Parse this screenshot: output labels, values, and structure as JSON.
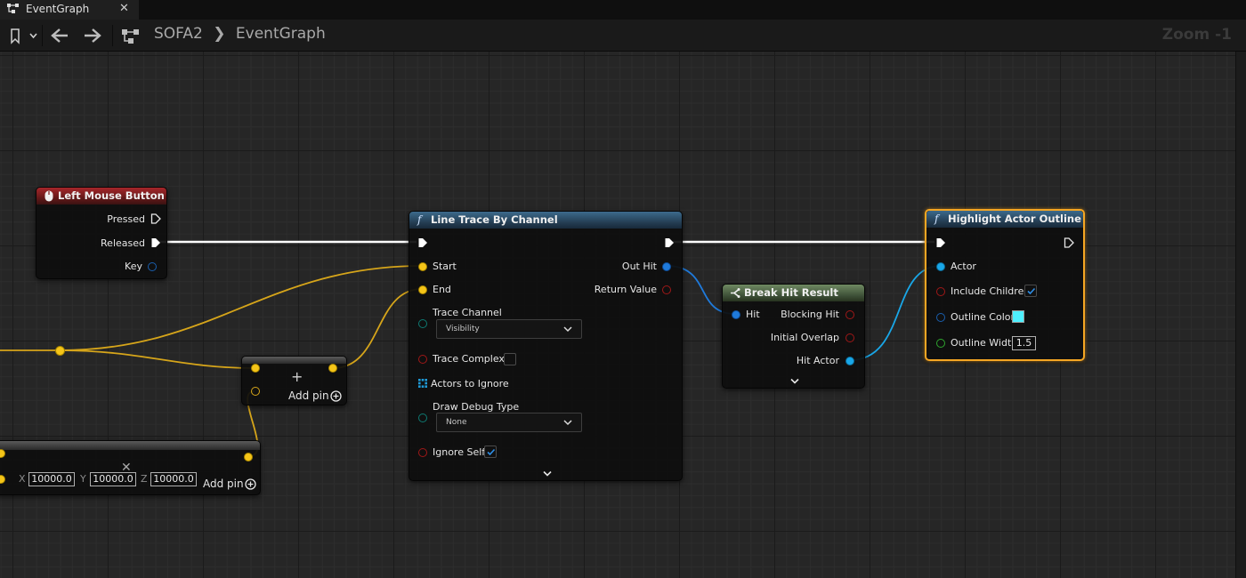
{
  "tab": {
    "title": "EventGraph",
    "close_glyph": "✕",
    "icon": "graph-icon"
  },
  "toolbar": {
    "breadcrumb": [
      "SOFA2",
      "EventGraph"
    ],
    "breadcrumb_separator": "❯",
    "zoom": "Zoom -1",
    "icons": [
      "bookmark-icon",
      "back-arrow-icon",
      "forward-arrow-icon",
      "graph-icon"
    ]
  },
  "colors": {
    "exec_wire": "#ffffff",
    "vector_wire": "#f5c518",
    "struct_wire": "#1f7adb",
    "object_wire": "#19a7e8",
    "selection_outline": "#f5a623"
  },
  "nodes": {
    "left_mouse_button": {
      "title": "Left Mouse Button",
      "pins": {
        "pressed": "Pressed",
        "released": "Released",
        "key": "Key"
      }
    },
    "line_trace": {
      "title": "Line Trace By Channel",
      "inputs": {
        "start": "Start",
        "end": "End",
        "trace_channel": "Trace Channel",
        "trace_channel_value": "Visibility",
        "trace_complex": "Trace Complex",
        "actors_to_ignore": "Actors to Ignore",
        "draw_debug_type": "Draw Debug Type",
        "draw_debug_value": "None",
        "ignore_self": "Ignore Self"
      },
      "outputs": {
        "out_hit": "Out Hit",
        "return_value": "Return Value"
      },
      "trace_complex_checked": false,
      "ignore_self_checked": true
    },
    "break_hit_result": {
      "title": "Break Hit Result",
      "pins": {
        "hit": "Hit",
        "blocking_hit": "Blocking Hit",
        "initial_overlap": "Initial Overlap",
        "hit_actor": "Hit Actor"
      }
    },
    "highlight": {
      "title": "Highlight Actor Outline",
      "pins": {
        "actor": "Actor",
        "include_children": "Include Children",
        "outline_color": "Outline Color",
        "outline_width": "Outline Width"
      },
      "include_children_checked": true,
      "outline_color_value": "#4ef0ff",
      "outline_width_value": "1.5"
    },
    "add_node": {
      "add_pin_label": "Add pin",
      "plus_glyph": "+"
    },
    "make_vector": {
      "x_label": "X",
      "x_value": "10000.0",
      "y_label": "Y",
      "y_value": "10000.0",
      "z_label": "Z",
      "z_value": "10000.0",
      "add_pin_label": "Add pin",
      "delete_glyph": "✕"
    }
  }
}
